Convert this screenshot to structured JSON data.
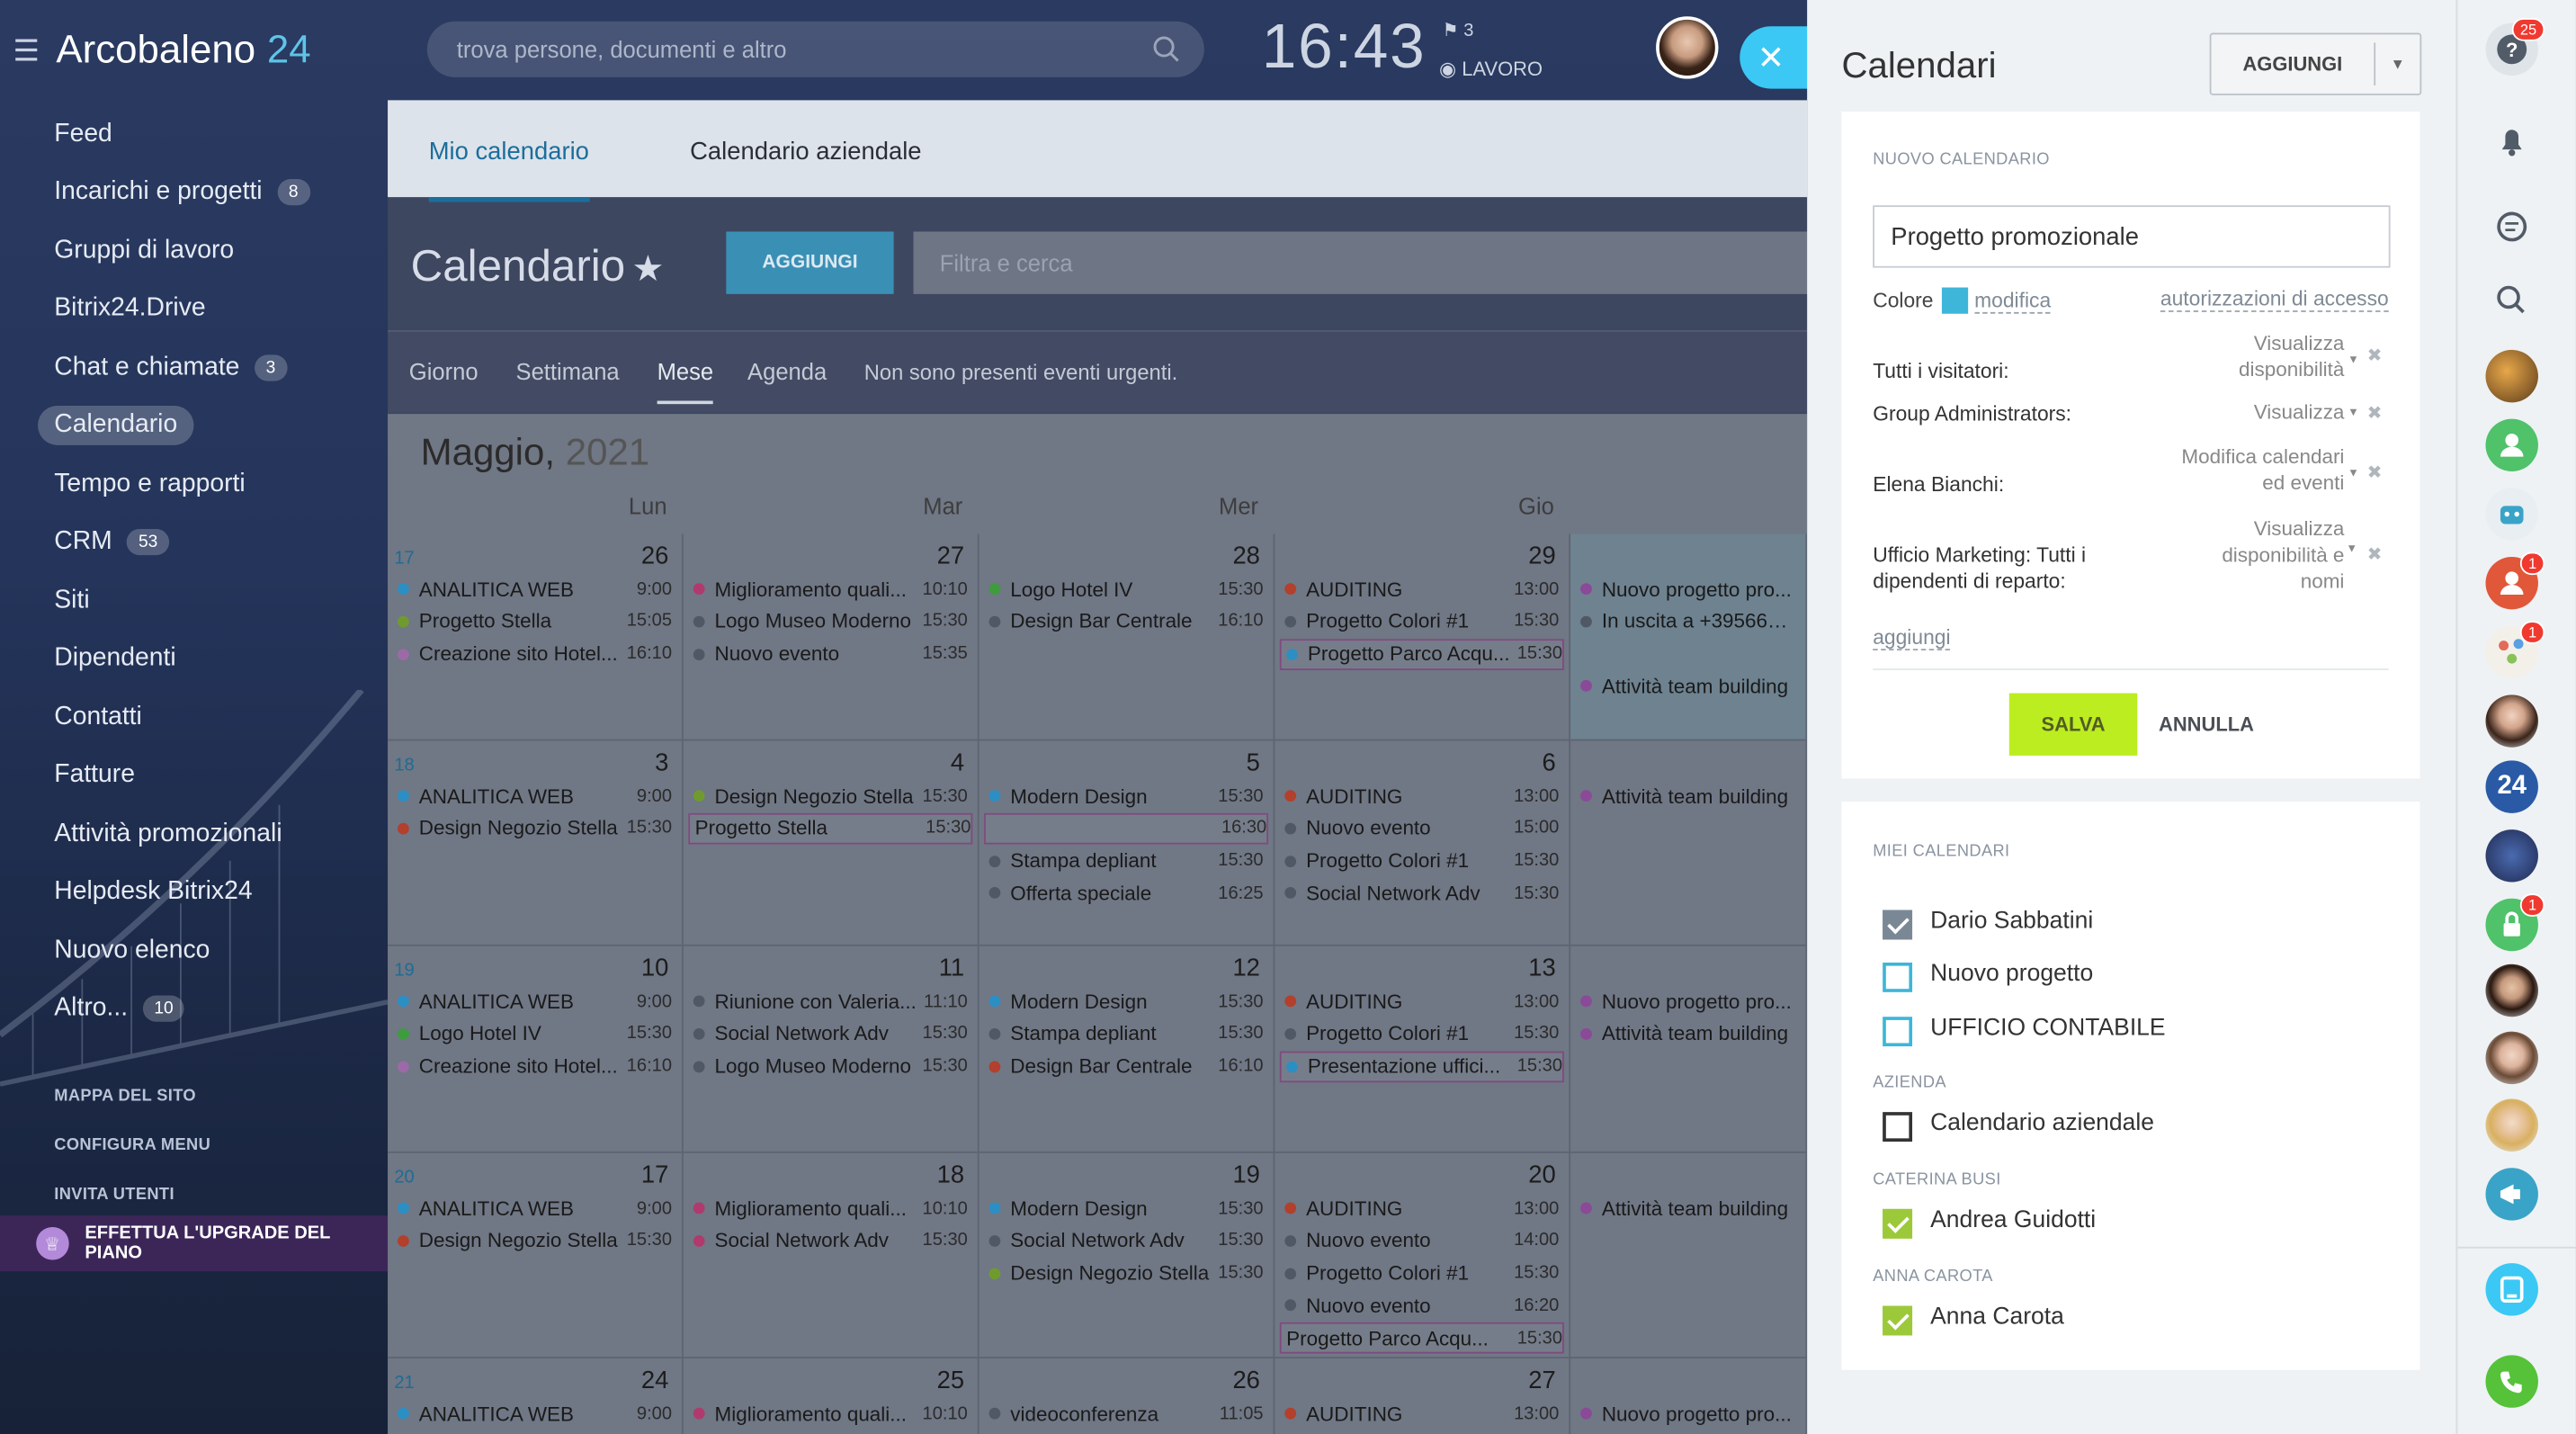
{
  "app": {
    "name": "Arcobaleno",
    "num": "24"
  },
  "search": {
    "placeholder": "trova persone, documenti e altro"
  },
  "clock": {
    "time": "16:43",
    "flags": "3",
    "status": "LAVORO"
  },
  "menu": [
    {
      "label": "Feed",
      "count": ""
    },
    {
      "label": "Incarichi e progetti",
      "count": "8"
    },
    {
      "label": "Gruppi di lavoro",
      "count": ""
    },
    {
      "label": "Bitrix24.Drive",
      "count": ""
    },
    {
      "label": "Chat e chiamate",
      "count": "3"
    },
    {
      "label": "Calendario",
      "count": "",
      "active": true
    },
    {
      "label": "Tempo e rapporti",
      "count": ""
    },
    {
      "label": "CRM",
      "count": "53"
    },
    {
      "label": "Siti",
      "count": ""
    },
    {
      "label": "Dipendenti",
      "count": ""
    },
    {
      "label": "Contatti",
      "count": ""
    },
    {
      "label": "Fatture",
      "count": ""
    },
    {
      "label": "Attività promozionali",
      "count": ""
    },
    {
      "label": "Helpdesk Bitrix24",
      "count": ""
    },
    {
      "label": "Nuovo elenco",
      "count": ""
    },
    {
      "label": "Altro...",
      "count": "10"
    }
  ],
  "small_links": [
    "MAPPA DEL SITO",
    "CONFIGURA MENU",
    "INVITA UTENTI"
  ],
  "upgrade": "EFFETTUA L'UPGRADE DEL PIANO",
  "calendar": {
    "tabs": [
      "Mio calendario",
      "Calendario aziendale"
    ],
    "title": "Calendario",
    "add": "AGGIUNGI",
    "filter_placeholder": "Filtra e cerca",
    "views": [
      "Giorno",
      "Settimana",
      "Mese",
      "Agenda"
    ],
    "urgent": "Non sono presenti eventi urgenti.",
    "month": "Maggio,",
    "year": "2021",
    "dow": [
      "Lun",
      "Mar",
      "Mer",
      "Gio"
    ],
    "weeks": [
      {
        "wk": "17",
        "days": [
          {
            "d": "26",
            "ev": [
              {
                "n": "ANALITICA WEB",
                "t": "9:00",
                "c": "#2c8fc4"
              },
              {
                "n": "Progetto Stella",
                "t": "15:05",
                "c": "#6f9b2e"
              },
              {
                "n": "Creazione sito Hotel...",
                "t": "16:10",
                "c": "#9c6aa6"
              }
            ]
          },
          {
            "d": "27",
            "ev": [
              {
                "n": "Miglioramento quali...",
                "t": "10:10",
                "c": "#b03a6e"
              },
              {
                "n": "Logo Museo Moderno",
                "t": "15:30",
                "c": "#505866"
              },
              {
                "n": "Nuovo evento",
                "t": "15:35",
                "c": "#505866"
              }
            ]
          },
          {
            "d": "28",
            "ev": [
              {
                "n": "Logo Hotel IV",
                "t": "15:30",
                "c": "#3e9c3e"
              },
              {
                "n": "Design Bar Centrale",
                "t": "16:10",
                "c": "#505866"
              }
            ]
          },
          {
            "d": "29",
            "ev": [
              {
                "n": "AUDITING",
                "t": "13:00",
                "c": "#b2402c"
              },
              {
                "n": "Progetto Colori #1",
                "t": "15:30",
                "c": "#505866"
              },
              {
                "n": "Progetto Parco Acqu...",
                "t": "15:30",
                "c": "#2c8fc4",
                "box": true
              }
            ]
          },
          {
            "d": "",
            "today": true,
            "ev": [
              {
                "n": "Nuovo progetto pro...",
                "t": "",
                "c": "#8a4a98"
              },
              {
                "n": "In uscita a +3956678...",
                "t": "",
                "c": "#505866"
              },
              {
                "n": "",
                "t": "",
                "c": ""
              },
              {
                "n": "Attività team building",
                "t": "",
                "c": "#8a4a98"
              }
            ]
          }
        ]
      },
      {
        "wk": "18",
        "days": [
          {
            "d": "3",
            "ev": [
              {
                "n": "ANALITICA WEB",
                "t": "9:00",
                "c": "#2c8fc4"
              },
              {
                "n": "Design Negozio Stella",
                "t": "15:30",
                "c": "#b2402c"
              }
            ]
          },
          {
            "d": "4",
            "ev": [
              {
                "n": "Design Negozio Stella",
                "t": "15:30",
                "c": "#6f9b2e"
              },
              {
                "n": "Progetto Stella",
                "t": "15:30",
                "c": "",
                "box": true
              }
            ]
          },
          {
            "d": "5",
            "ev": [
              {
                "n": "Modern Design",
                "t": "15:30",
                "c": "#2c8fc4"
              },
              {
                "n": "",
                "t": "16:30",
                "c": "",
                "box": true
              },
              {
                "n": "Stampa depliant",
                "t": "15:30",
                "c": "#505866"
              },
              {
                "n": "Offerta speciale",
                "t": "16:25",
                "c": "#505866"
              }
            ]
          },
          {
            "d": "6",
            "ev": [
              {
                "n": "AUDITING",
                "t": "13:00",
                "c": "#b2402c"
              },
              {
                "n": "Nuovo evento",
                "t": "15:00",
                "c": "#505866"
              },
              {
                "n": "Progetto Colori #1",
                "t": "15:30",
                "c": "#505866"
              },
              {
                "n": "Social Network Adv",
                "t": "15:30",
                "c": "#505866"
              }
            ]
          },
          {
            "d": "",
            "ev": [
              {
                "n": "Attività team building",
                "t": "",
                "c": "#8a4a98"
              }
            ]
          }
        ]
      },
      {
        "wk": "19",
        "days": [
          {
            "d": "10",
            "ev": [
              {
                "n": "ANALITICA WEB",
                "t": "9:00",
                "c": "#2c8fc4"
              },
              {
                "n": "Logo Hotel IV",
                "t": "15:30",
                "c": "#3e9c3e"
              },
              {
                "n": "Creazione sito Hotel...",
                "t": "16:10",
                "c": "#9c6aa6"
              }
            ]
          },
          {
            "d": "11",
            "ev": [
              {
                "n": "Riunione con Valeria...",
                "t": "11:10",
                "c": "#505866"
              },
              {
                "n": "Social Network Adv",
                "t": "15:30",
                "c": "#505866"
              },
              {
                "n": "Logo Museo Moderno",
                "t": "15:30",
                "c": "#505866"
              }
            ]
          },
          {
            "d": "12",
            "ev": [
              {
                "n": "Modern Design",
                "t": "15:30",
                "c": "#2c8fc4"
              },
              {
                "n": "Stampa depliant",
                "t": "15:30",
                "c": "#505866"
              },
              {
                "n": "Design Bar Centrale",
                "t": "16:10",
                "c": "#b2402c"
              }
            ]
          },
          {
            "d": "13",
            "ev": [
              {
                "n": "AUDITING",
                "t": "13:00",
                "c": "#b2402c"
              },
              {
                "n": "Progetto Colori #1",
                "t": "15:30",
                "c": "#505866"
              },
              {
                "n": "Presentazione uffici...",
                "t": "15:30",
                "c": "#2c8fc4",
                "box": true
              }
            ]
          },
          {
            "d": "",
            "ev": [
              {
                "n": "Nuovo progetto pro...",
                "t": "",
                "c": "#8a4a98"
              },
              {
                "n": "Attività team building",
                "t": "",
                "c": "#8a4a98"
              }
            ]
          }
        ]
      },
      {
        "wk": "20",
        "days": [
          {
            "d": "17",
            "ev": [
              {
                "n": "ANALITICA WEB",
                "t": "9:00",
                "c": "#2c8fc4"
              },
              {
                "n": "Design Negozio Stella",
                "t": "15:30",
                "c": "#b2402c"
              }
            ]
          },
          {
            "d": "18",
            "ev": [
              {
                "n": "Miglioramento quali...",
                "t": "10:10",
                "c": "#b03a6e"
              },
              {
                "n": "Social Network Adv",
                "t": "15:30",
                "c": "#b03a6e"
              }
            ]
          },
          {
            "d": "19",
            "ev": [
              {
                "n": "Modern Design",
                "t": "15:30",
                "c": "#2c8fc4"
              },
              {
                "n": "Social Network Adv",
                "t": "15:30",
                "c": "#505866"
              },
              {
                "n": "Design Negozio Stella",
                "t": "15:30",
                "c": "#6f9b2e"
              }
            ]
          },
          {
            "d": "20",
            "ev": [
              {
                "n": "AUDITING",
                "t": "13:00",
                "c": "#b2402c"
              },
              {
                "n": "Nuovo evento",
                "t": "14:00",
                "c": "#505866"
              },
              {
                "n": "Progetto Colori #1",
                "t": "15:30",
                "c": "#505866"
              },
              {
                "n": "Nuovo evento",
                "t": "16:20",
                "c": "#505866"
              },
              {
                "n": "Progetto Parco Acqu...",
                "t": "15:30",
                "c": "",
                "box": true
              }
            ]
          },
          {
            "d": "",
            "ev": [
              {
                "n": "Attività team building",
                "t": "",
                "c": "#8a4a98"
              }
            ]
          }
        ]
      },
      {
        "wk": "21",
        "days": [
          {
            "d": "24",
            "ev": [
              {
                "n": "ANALITICA WEB",
                "t": "9:00",
                "c": "#2c8fc4"
              }
            ]
          },
          {
            "d": "25",
            "ev": [
              {
                "n": "Miglioramento quali...",
                "t": "10:10",
                "c": "#b03a6e"
              }
            ]
          },
          {
            "d": "26",
            "ev": [
              {
                "n": "videoconferenza",
                "t": "11:05",
                "c": "#505866"
              }
            ]
          },
          {
            "d": "27",
            "ev": [
              {
                "n": "AUDITING",
                "t": "13:00",
                "c": "#b2402c"
              }
            ]
          },
          {
            "d": "",
            "ev": [
              {
                "n": "Nuovo progetto pro...",
                "t": "",
                "c": "#8a4a98"
              }
            ]
          }
        ]
      }
    ]
  },
  "panel": {
    "title": "Calendari",
    "add": "AGGIUNGI",
    "new_section": "NUOVO CALENDARIO",
    "name_value": "Progetto promozionale",
    "color_label": "Colore",
    "color": "#3db6d9",
    "edit_link": "modifica",
    "access_link": "autorizzazioni di accesso",
    "permissions": [
      {
        "who": "Tutti i visitatori:",
        "sel": [
          "Visualizza",
          "disponibilità"
        ]
      },
      {
        "who": "Group Administrators:",
        "sel": [
          "Visualizza"
        ]
      },
      {
        "who": "Elena Bianchi:",
        "sel": [
          "Modifica calendari",
          "ed eventi"
        ]
      },
      {
        "who": "Ufficio Marketing: Tutti i\ndipendenti di reparto:",
        "sel": [
          "Visualizza",
          "disponibilità e",
          "nomi"
        ]
      }
    ],
    "add_link": "aggiungi",
    "save": "SALVA",
    "cancel": "ANNULLA",
    "my_section": "MIEI CALENDARI",
    "my": [
      {
        "label": "Dario Sabbatini",
        "state": "on"
      },
      {
        "label": "Nuovo progetto",
        "state": "off"
      },
      {
        "label": "UFFICIO CONTABILE",
        "state": "off"
      }
    ],
    "company_section": "AZIENDA",
    "company": [
      {
        "label": "Calendario aziendale",
        "state": "dark"
      }
    ],
    "caterina_section": "CATERINA BUSI",
    "caterina": [
      {
        "label": "Andrea Guidotti",
        "state": "green"
      }
    ],
    "anna_section": "ANNA CAROTA",
    "anna": [
      {
        "label": "Anna Carota",
        "state": "green"
      }
    ]
  },
  "rightbar": {
    "help_badge": "25",
    "badges": [
      "1",
      "1",
      "1"
    ],
    "logo_num": "24"
  }
}
